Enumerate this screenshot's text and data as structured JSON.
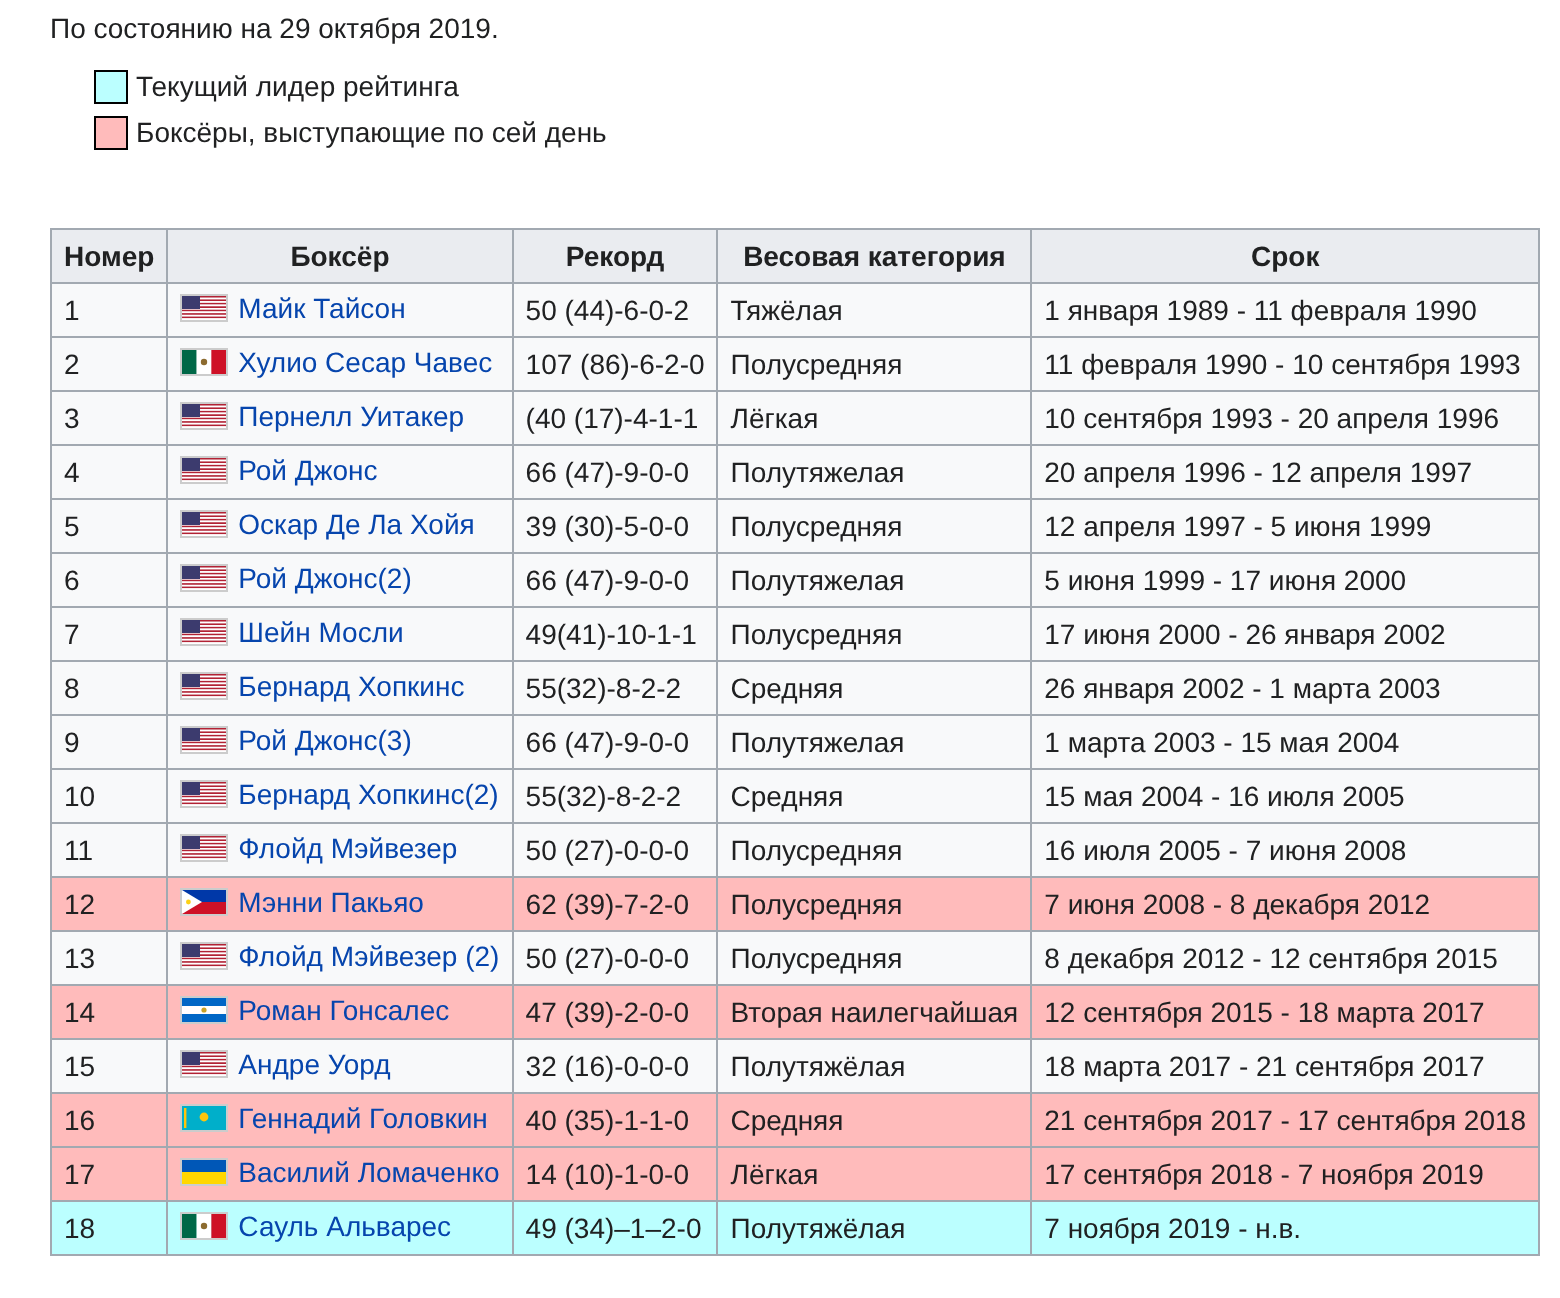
{
  "note": "По состоянию на 29 октября 2019.",
  "legend": [
    {
      "label": "Текущий лидер рейтинга",
      "color": "#bbffff"
    },
    {
      "label": "Боксёры, выступающие по сей день",
      "color": "#ffbbbb"
    }
  ],
  "table": {
    "columns": [
      "Номер",
      "Боксёр",
      "Рекорд",
      "Весовая категория",
      "Срок"
    ],
    "rows": [
      {
        "number": "1",
        "kind": "us",
        "boxer": "Майк Тайсон",
        "record": "50 (44)-6-0-2",
        "weight_class": "Тяжёлая",
        "term": "1 января 1989 - 11 февраля 1990",
        "color": "#f8f9fa"
      },
      {
        "number": "2",
        "kind": "mx",
        "boxer": "Хулио Сесар Чавес",
        "record": "107 (86)-6-2-0",
        "weight_class": "Полусредняя",
        "term": "11 февраля 1990 - 10 сентября 1993",
        "color": "#f8f9fa"
      },
      {
        "number": "3",
        "kind": "us",
        "boxer": "Пернелл Уитакер",
        "record": "(40 (17)-4-1-1",
        "weight_class": "Лёгкая",
        "term": "10 сентября 1993 - 20 апреля 1996",
        "color": "#f8f9fa"
      },
      {
        "number": "4",
        "kind": "us",
        "boxer": "Рой Джонс",
        "record": "66 (47)-9-0-0",
        "weight_class": "Полутяжелая",
        "term": "20 апреля 1996 - 12 апреля 1997",
        "color": "#f8f9fa"
      },
      {
        "number": "5",
        "kind": "us",
        "boxer": "Оскар Де Ла Хойя",
        "record": "39 (30)-5-0-0",
        "weight_class": "Полусредняя",
        "term": "12 апреля 1997 - 5 июня 1999",
        "color": "#f8f9fa"
      },
      {
        "number": "6",
        "kind": "us",
        "boxer": "Рой Джонс(2)",
        "record": "66 (47)-9-0-0",
        "weight_class": "Полутяжелая",
        "term": "5 июня 1999 - 17 июня 2000",
        "color": "#f8f9fa"
      },
      {
        "number": "7",
        "kind": "us",
        "boxer": "Шейн Мосли",
        "record": "49(41)-10-1-1",
        "weight_class": "Полусредняя",
        "term": "17 июня 2000 - 26 января 2002",
        "color": "#f8f9fa"
      },
      {
        "number": "8",
        "kind": "us",
        "boxer": "Бернард Хопкинс",
        "record": "55(32)-8-2-2",
        "weight_class": "Средняя",
        "term": "26 января 2002 - 1 марта 2003",
        "color": "#f8f9fa"
      },
      {
        "number": "9",
        "kind": "us",
        "boxer": "Рой Джонс(3)",
        "record": "66 (47)-9-0-0",
        "weight_class": "Полутяжелая",
        "term": "1 марта 2003 - 15 мая 2004",
        "color": "#f8f9fa"
      },
      {
        "number": "10",
        "kind": "us",
        "boxer": "Бернард Хопкинс(2)",
        "record": "55(32)-8-2-2",
        "weight_class": "Средняя",
        "term": "15 мая 2004 - 16 июля 2005",
        "color": "#f8f9fa"
      },
      {
        "number": "11",
        "kind": "us",
        "boxer": "Флойд Мэйвезер",
        "record": "50 (27)-0-0-0",
        "weight_class": "Полусредняя",
        "term": "16 июля 2005 - 7 июня 2008",
        "color": "#f8f9fa"
      },
      {
        "number": "12",
        "kind": "ph",
        "boxer": "Мэнни Пакьяо",
        "record": "62 (39)-7-2-0",
        "weight_class": "Полусредняя",
        "term": "7 июня 2008 - 8 декабря 2012",
        "color": "#ffbbbb"
      },
      {
        "number": "13",
        "kind": "us",
        "boxer": "Флойд Мэйвезер (2)",
        "record": "50 (27)-0-0-0",
        "weight_class": "Полусредняя",
        "term": "8 декабря 2012 - 12 сентября 2015",
        "color": "#f8f9fa"
      },
      {
        "number": "14",
        "kind": "ni",
        "boxer": "Роман Гонсалес",
        "record": "47 (39)-2-0-0",
        "weight_class": "Вторая наилегчайшая",
        "term": "12 сентября 2015 - 18 марта 2017",
        "color": "#ffbbbb"
      },
      {
        "number": "15",
        "kind": "us",
        "boxer": "Андре Уорд",
        "record": "32 (16)-0-0-0",
        "weight_class": "Полутяжёлая",
        "term": "18 марта 2017 - 21 сентября 2017",
        "color": "#f8f9fa"
      },
      {
        "number": "16",
        "kind": "kz",
        "boxer": "Геннадий Головкин",
        "record": "40 (35)-1-1-0",
        "weight_class": "Средняя",
        "term": "21 сентября 2017 - 17 сентября 2018",
        "color": "#ffbbbb"
      },
      {
        "number": "17",
        "kind": "ua",
        "boxer": "Василий Ломаченко",
        "record": "14 (10)-1-0-0",
        "weight_class": "Лёгкая",
        "term": "17 сентября 2018 - 7 ноября 2019",
        "color": "#ffbbbb"
      },
      {
        "number": "18",
        "kind": "mx",
        "boxer": "Сауль Альварес",
        "record": "49 (34)–1–2-0",
        "weight_class": "Полутяжёлая",
        "term": "7 ноября 2019 - н.в.",
        "color": "#bbffff"
      }
    ]
  }
}
